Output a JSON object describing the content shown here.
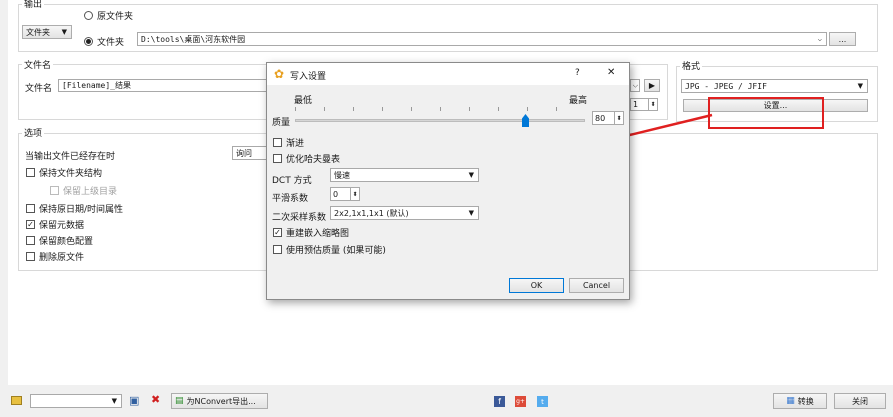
{
  "output": {
    "legend": "输出",
    "radio_original": "原文件夹",
    "radio_folder": "文件夹",
    "folder_mode_button": "文件夹",
    "folder_path": "D:\\tools\\桌面\\河东软件园",
    "browse_label": "..."
  },
  "filename": {
    "legend": "文件名",
    "label": "文件名",
    "value": "[Filename]_结果",
    "spin_value": "1"
  },
  "format": {
    "legend": "格式",
    "selected": "JPG - JPEG / JFIF",
    "settings_button": "设置..."
  },
  "options": {
    "legend": "选项",
    "if_exists_label": "当输出文件已经存在时",
    "if_exists_value": "询问",
    "items": [
      {
        "label": "保持文件夹结构",
        "checked": false,
        "disabled": false
      },
      {
        "label": "保留上级目录",
        "checked": false,
        "disabled": true
      },
      {
        "label": "保持原日期/时间属性",
        "checked": false,
        "disabled": false
      },
      {
        "label": "保留元数据",
        "checked": true,
        "disabled": false
      },
      {
        "label": "保留颜色配置",
        "checked": false,
        "disabled": false
      },
      {
        "label": "删除原文件",
        "checked": false,
        "disabled": false
      }
    ]
  },
  "dialog": {
    "title": "写入设置",
    "help": "?",
    "close": "✕",
    "quality_low": "最低",
    "quality_high": "最高",
    "quality_label": "质量",
    "quality_value": "80",
    "progressive": "渐进",
    "optimize_huffman": "优化哈夫曼表",
    "dct_label": "DCT 方式",
    "dct_value": "慢速",
    "smoothing_label": "平滑系数",
    "smoothing_value": "0",
    "subsampling_label": "二次采样系数",
    "subsampling_value": "2x2,1x1,1x1 (默认)",
    "rebuild_thumbnail": "重建嵌入缩略图",
    "use_estimated_quality": "使用预估质量 (如果可能)",
    "ok": "OK",
    "cancel": "Cancel"
  },
  "bottom": {
    "export_label": "为NConvert导出...",
    "convert_label": "转换",
    "close_label": "关闭"
  },
  "colors": {
    "annotation_red": "#e02020",
    "accent_blue": "#0078d7"
  }
}
